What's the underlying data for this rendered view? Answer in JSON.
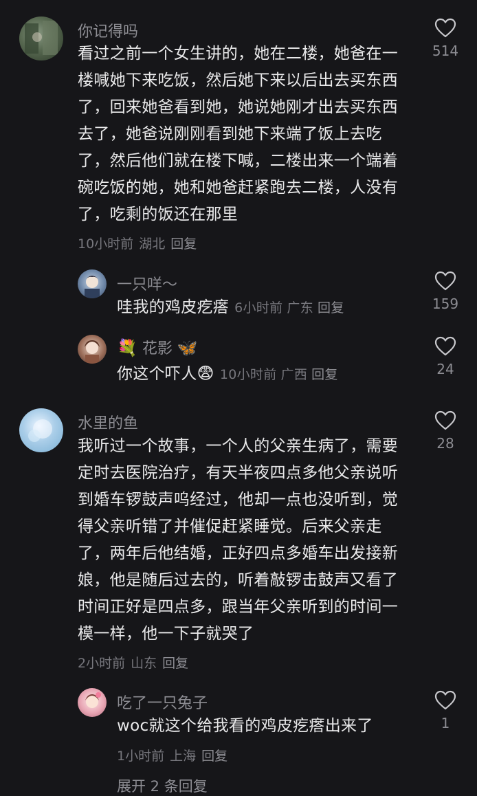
{
  "comments": [
    {
      "username": "你记得吗",
      "text": "看过之前一个女生讲的，她在二楼，她爸在一楼喊她下来吃饭，然后她下来以后出去买东西了，回来她爸看到她，她说她刚才出去买东西去了，她爸说刚刚看到她下来端了饭上去吃了，然后他们就在楼下喊，二楼出来一个端着碗吃饭的她，她和她爸赶紧跑去二楼，人没有了，吃剩的饭还在那里",
      "time": "10小时前",
      "location": "湖北",
      "reply_label": "回复",
      "likes": "514",
      "replies": [
        {
          "username": "一只咩～",
          "text": "哇我的鸡皮疙瘩",
          "time": "6小时前",
          "location": "广东",
          "reply_label": "回复",
          "likes": "159"
        },
        {
          "username": "花影",
          "username_prefix_emoji": "💐",
          "username_suffix_emoji": "🦋",
          "text": "你这个吓人",
          "text_emoji": "😨",
          "time": "10小时前",
          "location": "广西",
          "reply_label": "回复",
          "likes": "24"
        }
      ]
    },
    {
      "username": "水里的鱼",
      "text": "我听过一个故事，一个人的父亲生病了，需要定时去医院治疗，有天半夜四点多他父亲说听到婚车锣鼓声呜经过，他却一点也没听到，觉得父亲听错了并催促赶紧睡觉。后来父亲走了，两年后他结婚，正好四点多婚车出发接新娘，他是随后过去的，听着敲锣击鼓声又看了时间正好是四点多，跟当年父亲听到的时间一模一样，他一下子就哭了",
      "time": "2小时前",
      "location": "山东",
      "reply_label": "回复",
      "likes": "28",
      "replies": [
        {
          "username": "吃了一只兔子",
          "text": "woc就这个给我看的鸡皮疙瘩出来了",
          "time": "1小时前",
          "location": "上海",
          "reply_label": "回复",
          "likes": "1"
        }
      ],
      "more_replies_label": "展开 2 条回复"
    }
  ],
  "colors": {
    "background": "#161619",
    "text": "#e9e9ea",
    "muted": "#8d8d93"
  },
  "icons": {
    "like": "heart-outline-icon"
  }
}
